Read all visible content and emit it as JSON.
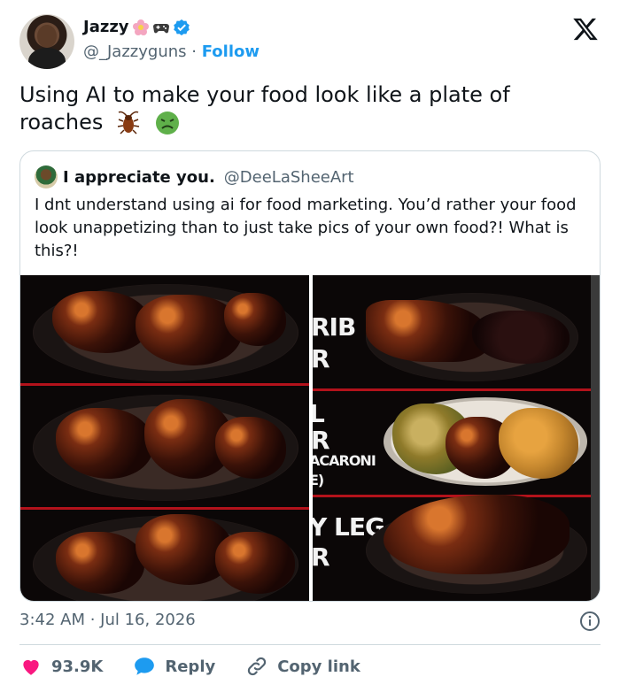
{
  "author": {
    "display_name": "Jazzy",
    "handle": "@_Jazzyguns",
    "separator": "·",
    "follow_label": "Follow",
    "name_emojis": [
      "flower-icon",
      "game-controller-icon",
      "verified-badge-icon"
    ]
  },
  "tweet": {
    "text": "Using AI to make your food look like a plate of roaches",
    "trailing_icons": [
      "cockroach-icon",
      "nauseated-face-icon"
    ]
  },
  "quote": {
    "display_name": "I appreciate you.",
    "handle": "@DeeLaSheeArt",
    "text": "I dnt understand using ai for food marketing. You’d rather your food look unappetizing than to just take pics of your own food?! What is this?!",
    "menu_labels": [
      "RIB",
      "R",
      "L",
      "R",
      "ACARONI",
      "E)",
      "Y LEG",
      "R"
    ]
  },
  "meta": {
    "timestamp": "3:42 AM · Jul 16, 2026"
  },
  "actions": {
    "likes_count": "93.9K",
    "reply_label": "Reply",
    "copy_link_label": "Copy link"
  },
  "colors": {
    "accent": "#1d9bf0",
    "like": "#f91880",
    "text_secondary": "#536471",
    "border": "#cfd9de"
  }
}
